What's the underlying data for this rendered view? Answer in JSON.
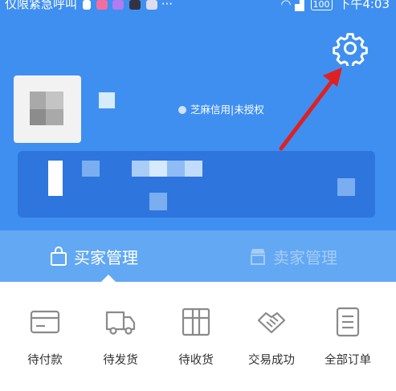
{
  "status_bar": {
    "carrier": "仅限紧急呼叫",
    "battery": "100",
    "time": "下午4:03"
  },
  "profile": {
    "credit_text": "芝麻信用|未授权"
  },
  "tabs": [
    {
      "label": "买家管理",
      "active": true
    },
    {
      "label": "卖家管理",
      "active": false
    }
  ],
  "orders": [
    {
      "label": "待付款",
      "icon": "wallet-card-icon"
    },
    {
      "label": "待发货",
      "icon": "truck-icon"
    },
    {
      "label": "待收货",
      "icon": "package-box-icon"
    },
    {
      "label": "交易成功",
      "icon": "handshake-icon"
    },
    {
      "label": "全部订单",
      "icon": "list-document-icon"
    }
  ],
  "colors": {
    "header_blue": "#3f8ff0",
    "card_blue": "#2e75dd",
    "tab_blue": "#62a8f3",
    "arrow_red": "#e02020"
  }
}
